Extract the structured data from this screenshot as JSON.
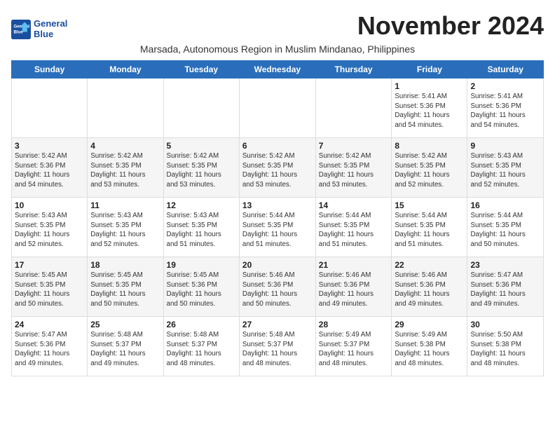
{
  "logo": {
    "line1": "General",
    "line2": "Blue"
  },
  "title": "November 2024",
  "location": "Marsada, Autonomous Region in Muslim Mindanao, Philippines",
  "headers": [
    "Sunday",
    "Monday",
    "Tuesday",
    "Wednesday",
    "Thursday",
    "Friday",
    "Saturday"
  ],
  "weeks": [
    [
      {
        "day": "",
        "info": ""
      },
      {
        "day": "",
        "info": ""
      },
      {
        "day": "",
        "info": ""
      },
      {
        "day": "",
        "info": ""
      },
      {
        "day": "",
        "info": ""
      },
      {
        "day": "1",
        "info": "Sunrise: 5:41 AM\nSunset: 5:36 PM\nDaylight: 11 hours\nand 54 minutes."
      },
      {
        "day": "2",
        "info": "Sunrise: 5:41 AM\nSunset: 5:36 PM\nDaylight: 11 hours\nand 54 minutes."
      }
    ],
    [
      {
        "day": "3",
        "info": "Sunrise: 5:42 AM\nSunset: 5:36 PM\nDaylight: 11 hours\nand 54 minutes."
      },
      {
        "day": "4",
        "info": "Sunrise: 5:42 AM\nSunset: 5:35 PM\nDaylight: 11 hours\nand 53 minutes."
      },
      {
        "day": "5",
        "info": "Sunrise: 5:42 AM\nSunset: 5:35 PM\nDaylight: 11 hours\nand 53 minutes."
      },
      {
        "day": "6",
        "info": "Sunrise: 5:42 AM\nSunset: 5:35 PM\nDaylight: 11 hours\nand 53 minutes."
      },
      {
        "day": "7",
        "info": "Sunrise: 5:42 AM\nSunset: 5:35 PM\nDaylight: 11 hours\nand 53 minutes."
      },
      {
        "day": "8",
        "info": "Sunrise: 5:42 AM\nSunset: 5:35 PM\nDaylight: 11 hours\nand 52 minutes."
      },
      {
        "day": "9",
        "info": "Sunrise: 5:43 AM\nSunset: 5:35 PM\nDaylight: 11 hours\nand 52 minutes."
      }
    ],
    [
      {
        "day": "10",
        "info": "Sunrise: 5:43 AM\nSunset: 5:35 PM\nDaylight: 11 hours\nand 52 minutes."
      },
      {
        "day": "11",
        "info": "Sunrise: 5:43 AM\nSunset: 5:35 PM\nDaylight: 11 hours\nand 52 minutes."
      },
      {
        "day": "12",
        "info": "Sunrise: 5:43 AM\nSunset: 5:35 PM\nDaylight: 11 hours\nand 51 minutes."
      },
      {
        "day": "13",
        "info": "Sunrise: 5:44 AM\nSunset: 5:35 PM\nDaylight: 11 hours\nand 51 minutes."
      },
      {
        "day": "14",
        "info": "Sunrise: 5:44 AM\nSunset: 5:35 PM\nDaylight: 11 hours\nand 51 minutes."
      },
      {
        "day": "15",
        "info": "Sunrise: 5:44 AM\nSunset: 5:35 PM\nDaylight: 11 hours\nand 51 minutes."
      },
      {
        "day": "16",
        "info": "Sunrise: 5:44 AM\nSunset: 5:35 PM\nDaylight: 11 hours\nand 50 minutes."
      }
    ],
    [
      {
        "day": "17",
        "info": "Sunrise: 5:45 AM\nSunset: 5:35 PM\nDaylight: 11 hours\nand 50 minutes."
      },
      {
        "day": "18",
        "info": "Sunrise: 5:45 AM\nSunset: 5:35 PM\nDaylight: 11 hours\nand 50 minutes."
      },
      {
        "day": "19",
        "info": "Sunrise: 5:45 AM\nSunset: 5:36 PM\nDaylight: 11 hours\nand 50 minutes."
      },
      {
        "day": "20",
        "info": "Sunrise: 5:46 AM\nSunset: 5:36 PM\nDaylight: 11 hours\nand 50 minutes."
      },
      {
        "day": "21",
        "info": "Sunrise: 5:46 AM\nSunset: 5:36 PM\nDaylight: 11 hours\nand 49 minutes."
      },
      {
        "day": "22",
        "info": "Sunrise: 5:46 AM\nSunset: 5:36 PM\nDaylight: 11 hours\nand 49 minutes."
      },
      {
        "day": "23",
        "info": "Sunrise: 5:47 AM\nSunset: 5:36 PM\nDaylight: 11 hours\nand 49 minutes."
      }
    ],
    [
      {
        "day": "24",
        "info": "Sunrise: 5:47 AM\nSunset: 5:36 PM\nDaylight: 11 hours\nand 49 minutes."
      },
      {
        "day": "25",
        "info": "Sunrise: 5:48 AM\nSunset: 5:37 PM\nDaylight: 11 hours\nand 49 minutes."
      },
      {
        "day": "26",
        "info": "Sunrise: 5:48 AM\nSunset: 5:37 PM\nDaylight: 11 hours\nand 48 minutes."
      },
      {
        "day": "27",
        "info": "Sunrise: 5:48 AM\nSunset: 5:37 PM\nDaylight: 11 hours\nand 48 minutes."
      },
      {
        "day": "28",
        "info": "Sunrise: 5:49 AM\nSunset: 5:37 PM\nDaylight: 11 hours\nand 48 minutes."
      },
      {
        "day": "29",
        "info": "Sunrise: 5:49 AM\nSunset: 5:38 PM\nDaylight: 11 hours\nand 48 minutes."
      },
      {
        "day": "30",
        "info": "Sunrise: 5:50 AM\nSunset: 5:38 PM\nDaylight: 11 hours\nand 48 minutes."
      }
    ]
  ]
}
